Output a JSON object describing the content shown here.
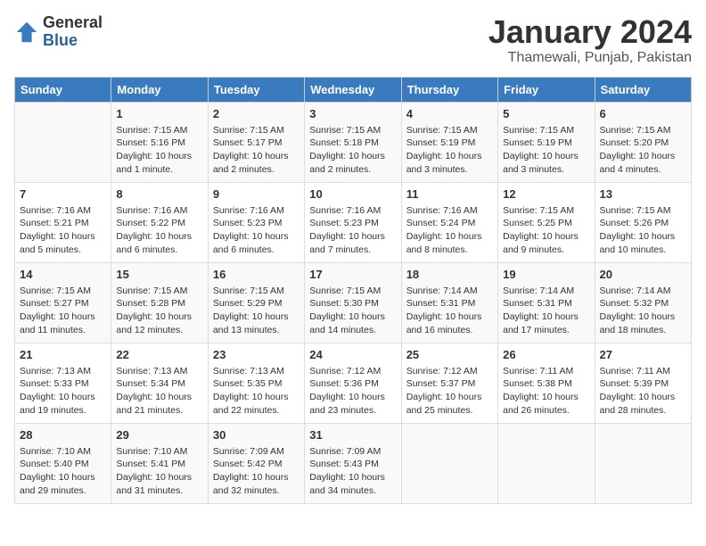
{
  "header": {
    "logo_general": "General",
    "logo_blue": "Blue",
    "month_title": "January 2024",
    "location": "Thamewali, Punjab, Pakistan"
  },
  "weekdays": [
    "Sunday",
    "Monday",
    "Tuesday",
    "Wednesday",
    "Thursday",
    "Friday",
    "Saturday"
  ],
  "weeks": [
    [
      {
        "day": "",
        "text": ""
      },
      {
        "day": "1",
        "text": "Sunrise: 7:15 AM\nSunset: 5:16 PM\nDaylight: 10 hours and 1 minute."
      },
      {
        "day": "2",
        "text": "Sunrise: 7:15 AM\nSunset: 5:17 PM\nDaylight: 10 hours and 2 minutes."
      },
      {
        "day": "3",
        "text": "Sunrise: 7:15 AM\nSunset: 5:18 PM\nDaylight: 10 hours and 2 minutes."
      },
      {
        "day": "4",
        "text": "Sunrise: 7:15 AM\nSunset: 5:19 PM\nDaylight: 10 hours and 3 minutes."
      },
      {
        "day": "5",
        "text": "Sunrise: 7:15 AM\nSunset: 5:19 PM\nDaylight: 10 hours and 3 minutes."
      },
      {
        "day": "6",
        "text": "Sunrise: 7:15 AM\nSunset: 5:20 PM\nDaylight: 10 hours and 4 minutes."
      }
    ],
    [
      {
        "day": "7",
        "text": "Sunrise: 7:16 AM\nSunset: 5:21 PM\nDaylight: 10 hours and 5 minutes."
      },
      {
        "day": "8",
        "text": "Sunrise: 7:16 AM\nSunset: 5:22 PM\nDaylight: 10 hours and 6 minutes."
      },
      {
        "day": "9",
        "text": "Sunrise: 7:16 AM\nSunset: 5:23 PM\nDaylight: 10 hours and 6 minutes."
      },
      {
        "day": "10",
        "text": "Sunrise: 7:16 AM\nSunset: 5:23 PM\nDaylight: 10 hours and 7 minutes."
      },
      {
        "day": "11",
        "text": "Sunrise: 7:16 AM\nSunset: 5:24 PM\nDaylight: 10 hours and 8 minutes."
      },
      {
        "day": "12",
        "text": "Sunrise: 7:15 AM\nSunset: 5:25 PM\nDaylight: 10 hours and 9 minutes."
      },
      {
        "day": "13",
        "text": "Sunrise: 7:15 AM\nSunset: 5:26 PM\nDaylight: 10 hours and 10 minutes."
      }
    ],
    [
      {
        "day": "14",
        "text": "Sunrise: 7:15 AM\nSunset: 5:27 PM\nDaylight: 10 hours and 11 minutes."
      },
      {
        "day": "15",
        "text": "Sunrise: 7:15 AM\nSunset: 5:28 PM\nDaylight: 10 hours and 12 minutes."
      },
      {
        "day": "16",
        "text": "Sunrise: 7:15 AM\nSunset: 5:29 PM\nDaylight: 10 hours and 13 minutes."
      },
      {
        "day": "17",
        "text": "Sunrise: 7:15 AM\nSunset: 5:30 PM\nDaylight: 10 hours and 14 minutes."
      },
      {
        "day": "18",
        "text": "Sunrise: 7:14 AM\nSunset: 5:31 PM\nDaylight: 10 hours and 16 minutes."
      },
      {
        "day": "19",
        "text": "Sunrise: 7:14 AM\nSunset: 5:31 PM\nDaylight: 10 hours and 17 minutes."
      },
      {
        "day": "20",
        "text": "Sunrise: 7:14 AM\nSunset: 5:32 PM\nDaylight: 10 hours and 18 minutes."
      }
    ],
    [
      {
        "day": "21",
        "text": "Sunrise: 7:13 AM\nSunset: 5:33 PM\nDaylight: 10 hours and 19 minutes."
      },
      {
        "day": "22",
        "text": "Sunrise: 7:13 AM\nSunset: 5:34 PM\nDaylight: 10 hours and 21 minutes."
      },
      {
        "day": "23",
        "text": "Sunrise: 7:13 AM\nSunset: 5:35 PM\nDaylight: 10 hours and 22 minutes."
      },
      {
        "day": "24",
        "text": "Sunrise: 7:12 AM\nSunset: 5:36 PM\nDaylight: 10 hours and 23 minutes."
      },
      {
        "day": "25",
        "text": "Sunrise: 7:12 AM\nSunset: 5:37 PM\nDaylight: 10 hours and 25 minutes."
      },
      {
        "day": "26",
        "text": "Sunrise: 7:11 AM\nSunset: 5:38 PM\nDaylight: 10 hours and 26 minutes."
      },
      {
        "day": "27",
        "text": "Sunrise: 7:11 AM\nSunset: 5:39 PM\nDaylight: 10 hours and 28 minutes."
      }
    ],
    [
      {
        "day": "28",
        "text": "Sunrise: 7:10 AM\nSunset: 5:40 PM\nDaylight: 10 hours and 29 minutes."
      },
      {
        "day": "29",
        "text": "Sunrise: 7:10 AM\nSunset: 5:41 PM\nDaylight: 10 hours and 31 minutes."
      },
      {
        "day": "30",
        "text": "Sunrise: 7:09 AM\nSunset: 5:42 PM\nDaylight: 10 hours and 32 minutes."
      },
      {
        "day": "31",
        "text": "Sunrise: 7:09 AM\nSunset: 5:43 PM\nDaylight: 10 hours and 34 minutes."
      },
      {
        "day": "",
        "text": ""
      },
      {
        "day": "",
        "text": ""
      },
      {
        "day": "",
        "text": ""
      }
    ]
  ]
}
